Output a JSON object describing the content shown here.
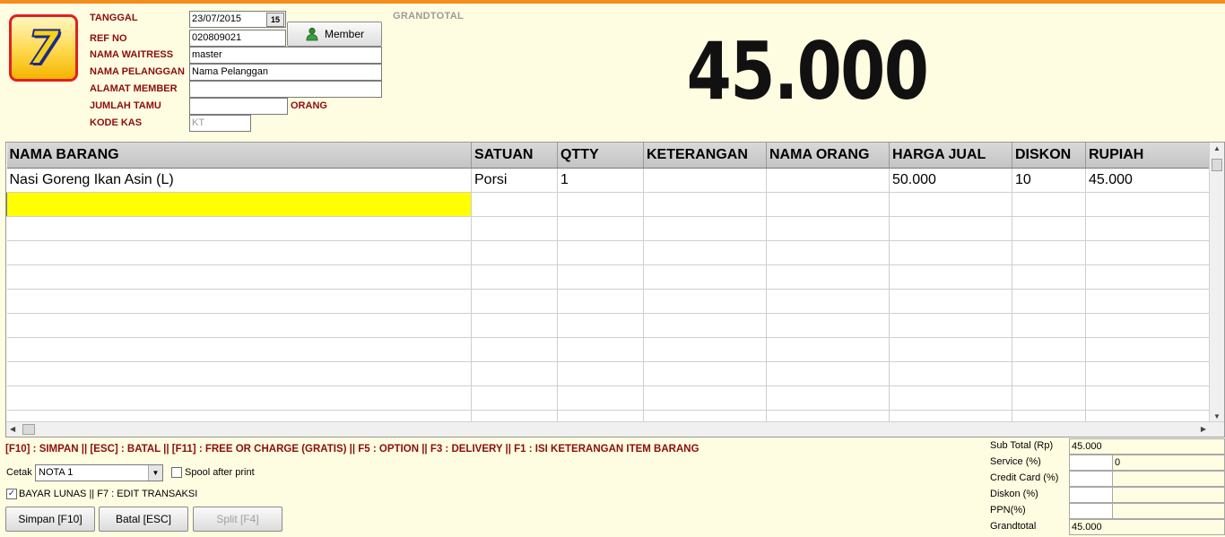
{
  "logo": {
    "glyph": "7"
  },
  "form": {
    "tanggal": {
      "label": "TANGGAL",
      "value": "23/07/2015",
      "calendar_glyph": "15"
    },
    "ref_no": {
      "label": "REF NO",
      "value": "020809021"
    },
    "nama_waitress": {
      "label": "NAMA WAITRESS",
      "value": "master"
    },
    "nama_pelanggan": {
      "label": "NAMA PELANGGAN",
      "value": "Nama Pelanggan"
    },
    "alamat_member": {
      "label": "ALAMAT MEMBER",
      "value": ""
    },
    "jumlah_tamu": {
      "label": "JUMLAH TAMU",
      "value": "",
      "suffix": "ORANG"
    },
    "kode_kas": {
      "label": "KODE KAS",
      "value": "KT"
    },
    "member_button": "Member"
  },
  "grandtotal": {
    "label": "GRANDTOTAL",
    "value": "45.000"
  },
  "grid": {
    "columns": [
      "NAMA BARANG",
      "SATUAN",
      "QTTY",
      "KETERANGAN",
      "NAMA ORANG",
      "HARGA JUAL",
      "DISKON",
      "RUPIAH"
    ],
    "rows": [
      [
        "Nasi Goreng Ikan Asin (L)",
        "Porsi",
        "1",
        "",
        "",
        "50.000",
        "10",
        "45.000"
      ]
    ]
  },
  "shortcuts": "[F10] : SIMPAN  ||  [ESC] : BATAL || [F11]  : FREE OR CHARGE (GRATIS) || F5 : OPTION || F3 : DELIVERY || F1 : ISI KETERANGAN ITEM BARANG",
  "print": {
    "cetak_label": "Cetak",
    "cetak_value": "NOTA 1",
    "spool_label": "Spool after print",
    "spool_checked": false,
    "bayar_label": "BAYAR LUNAS || F7 : EDIT TRANSAKSI",
    "bayar_checked": true
  },
  "buttons": {
    "simpan": "Simpan [F10]",
    "batal": "Batal [ESC]",
    "split": "Split [F4]"
  },
  "summary": {
    "sub_total": {
      "label": "Sub Total (Rp)",
      "value": "45.000"
    },
    "service": {
      "label": "Service (%)",
      "value": "",
      "amount": "0"
    },
    "credit_card": {
      "label": "Credit Card (%)",
      "value": "",
      "amount": ""
    },
    "diskon": {
      "label": "Diskon (%)",
      "value": "",
      "amount": ""
    },
    "ppn": {
      "label": "PPN(%)",
      "value": "",
      "amount": ""
    },
    "grandtotal": {
      "label": "Grandtotal",
      "value": "45.000"
    }
  },
  "colors": {
    "accent_bar": "#f58c1e",
    "label_red": "#8b0e0e",
    "active_cell": "#ffff00",
    "background": "#fffde1"
  }
}
